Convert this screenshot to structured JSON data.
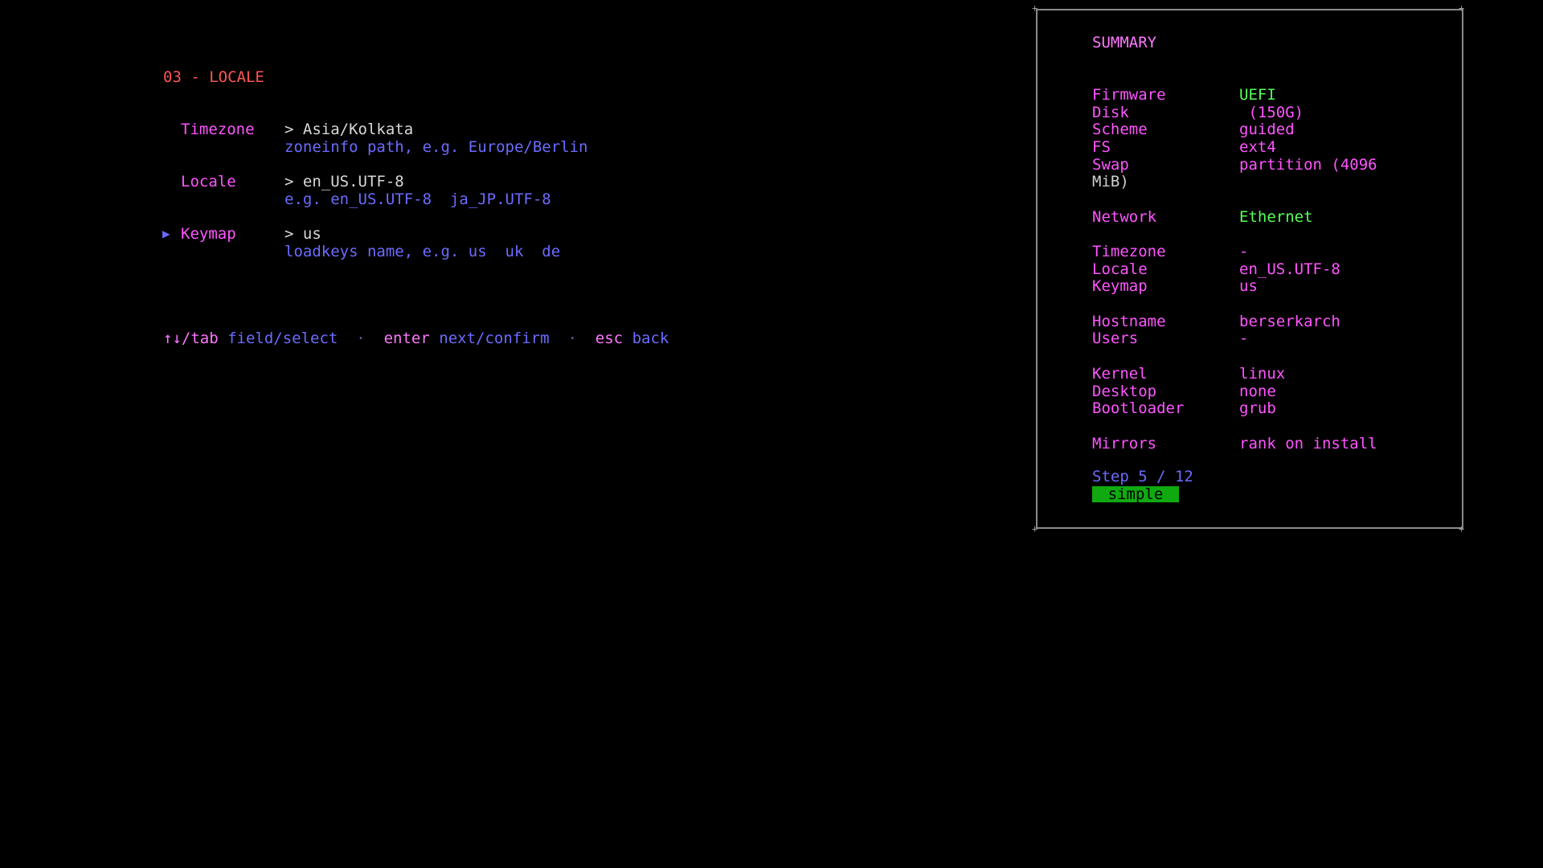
{
  "step_title": "03 - LOCALE",
  "fields": [
    {
      "label": "Timezone",
      "value": "> Asia/Kolkata",
      "hint": "zoneinfo path, e.g. Europe/Berlin"
    },
    {
      "label": "Locale",
      "value": "> en_US.UTF-8",
      "hint": "e.g. en_US.UTF-8  ja_JP.UTF-8"
    },
    {
      "label": "Keymap",
      "value": "> us",
      "hint": "loadkeys name, e.g. us  uk  de"
    }
  ],
  "focused_field": "Keymap",
  "cursor_glyph": "▶",
  "footer": {
    "nav_key": "↑↓/tab",
    "nav_desc": "field/select",
    "sep1": "·",
    "enter_key": "enter",
    "enter_desc": "next/confirm",
    "sep2": "·",
    "esc_key": "esc",
    "esc_desc": "back"
  },
  "summary": {
    "title": "SUMMARY",
    "rows": [
      {
        "key": "Firmware",
        "value": "UEFI",
        "color": "#55ff55"
      },
      {
        "key": "Disk",
        "value": " (150G)",
        "color": "#ff55ff"
      },
      {
        "key": "Scheme",
        "value": "guided",
        "color": "#ff55ff"
      },
      {
        "key": "FS",
        "value": "ext4",
        "color": "#ff55ff"
      },
      {
        "key": "Swap",
        "value": "partition (4096",
        "color": "#ff55ff"
      },
      {
        "key": "MiB)",
        "value": "",
        "color": "#cfcfcf"
      },
      {
        "key": "Network",
        "value": "Ethernet",
        "color": "#55ff55"
      },
      {
        "key": "Timezone",
        "value": "-",
        "color": "#ff55ff"
      },
      {
        "key": "Locale",
        "value": "en_US.UTF-8",
        "color": "#ff55ff"
      },
      {
        "key": "Keymap",
        "value": "us",
        "color": "#ff55ff"
      },
      {
        "key": "Hostname",
        "value": "berserkarch",
        "color": "#ff55ff"
      },
      {
        "key": "Users",
        "value": "-",
        "color": "#ff55ff"
      },
      {
        "key": "Kernel",
        "value": "linux",
        "color": "#ff55ff"
      },
      {
        "key": "Desktop",
        "value": "none",
        "color": "#ff55ff"
      },
      {
        "key": "Bootloader",
        "value": "grub",
        "color": "#ff55ff"
      },
      {
        "key": "Mirrors",
        "value": "rank on install",
        "color": "#ff55ff"
      }
    ],
    "step_text": "Step 5 / 12",
    "mode_badge": "simple"
  },
  "colors": {
    "background": "#000000",
    "title_red": "#ff5555",
    "label_magenta": "#ff55ff",
    "hint_blue": "#6b6bff",
    "value_green": "#55ff55",
    "badge_green": "#10aa10"
  }
}
